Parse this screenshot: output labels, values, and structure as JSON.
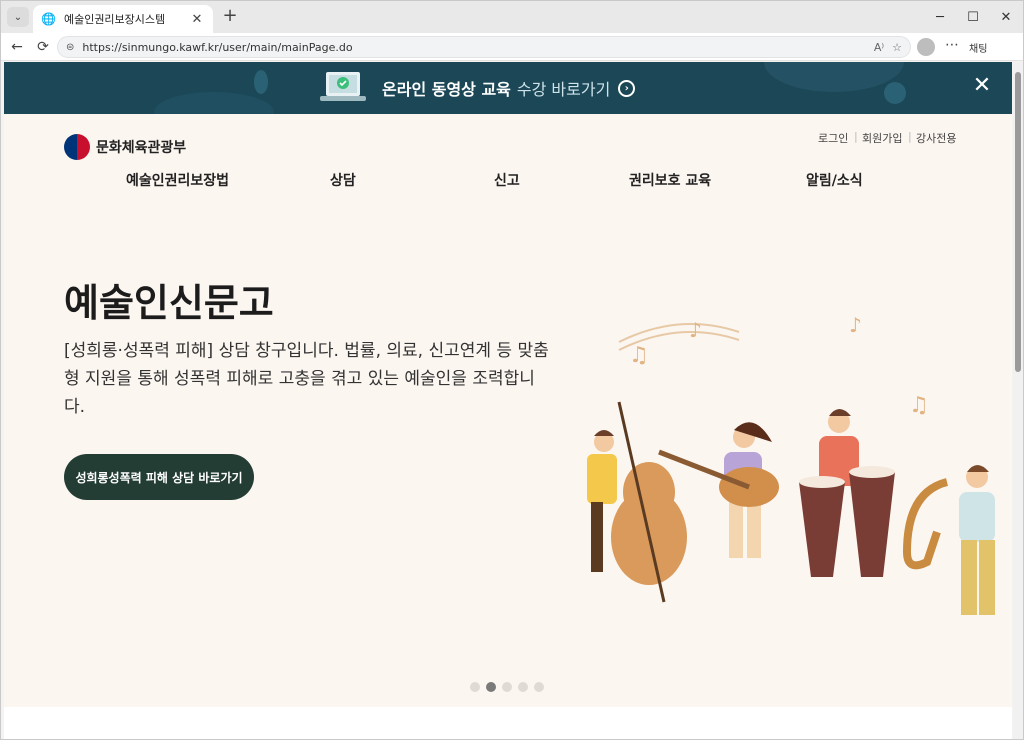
{
  "browser": {
    "tab_title": "예술인권리보장시스템",
    "url": "https://sinmungo.kawf.kr/user/main/mainPage.do",
    "reader_label": "A⁾",
    "copilot_label": "채팅"
  },
  "banner": {
    "strong": "온라인 동영상 교육",
    "light": "수강 바로가기",
    "arrow": "›",
    "close": "✕"
  },
  "header": {
    "logo_text": "문화체육관광부",
    "util": [
      "로그인",
      "회원가입",
      "강사전용"
    ],
    "menu": [
      "예술인권리보장법",
      "상담",
      "신고",
      "권리보호 교육",
      "알림/소식"
    ]
  },
  "hero": {
    "title": "예술인신문고",
    "description": "[성희롱·성폭력 피해] 상담 창구입니다. 법률, 의료, 신고연계 등 맞춤형 지원을 통해 성폭력 피해로 고충을 겪고 있는 예술인을 조력합니다.",
    "cta": "성희롱성폭력 피해 상담 바로가기"
  },
  "carousel": {
    "count": 5,
    "active": 2
  }
}
